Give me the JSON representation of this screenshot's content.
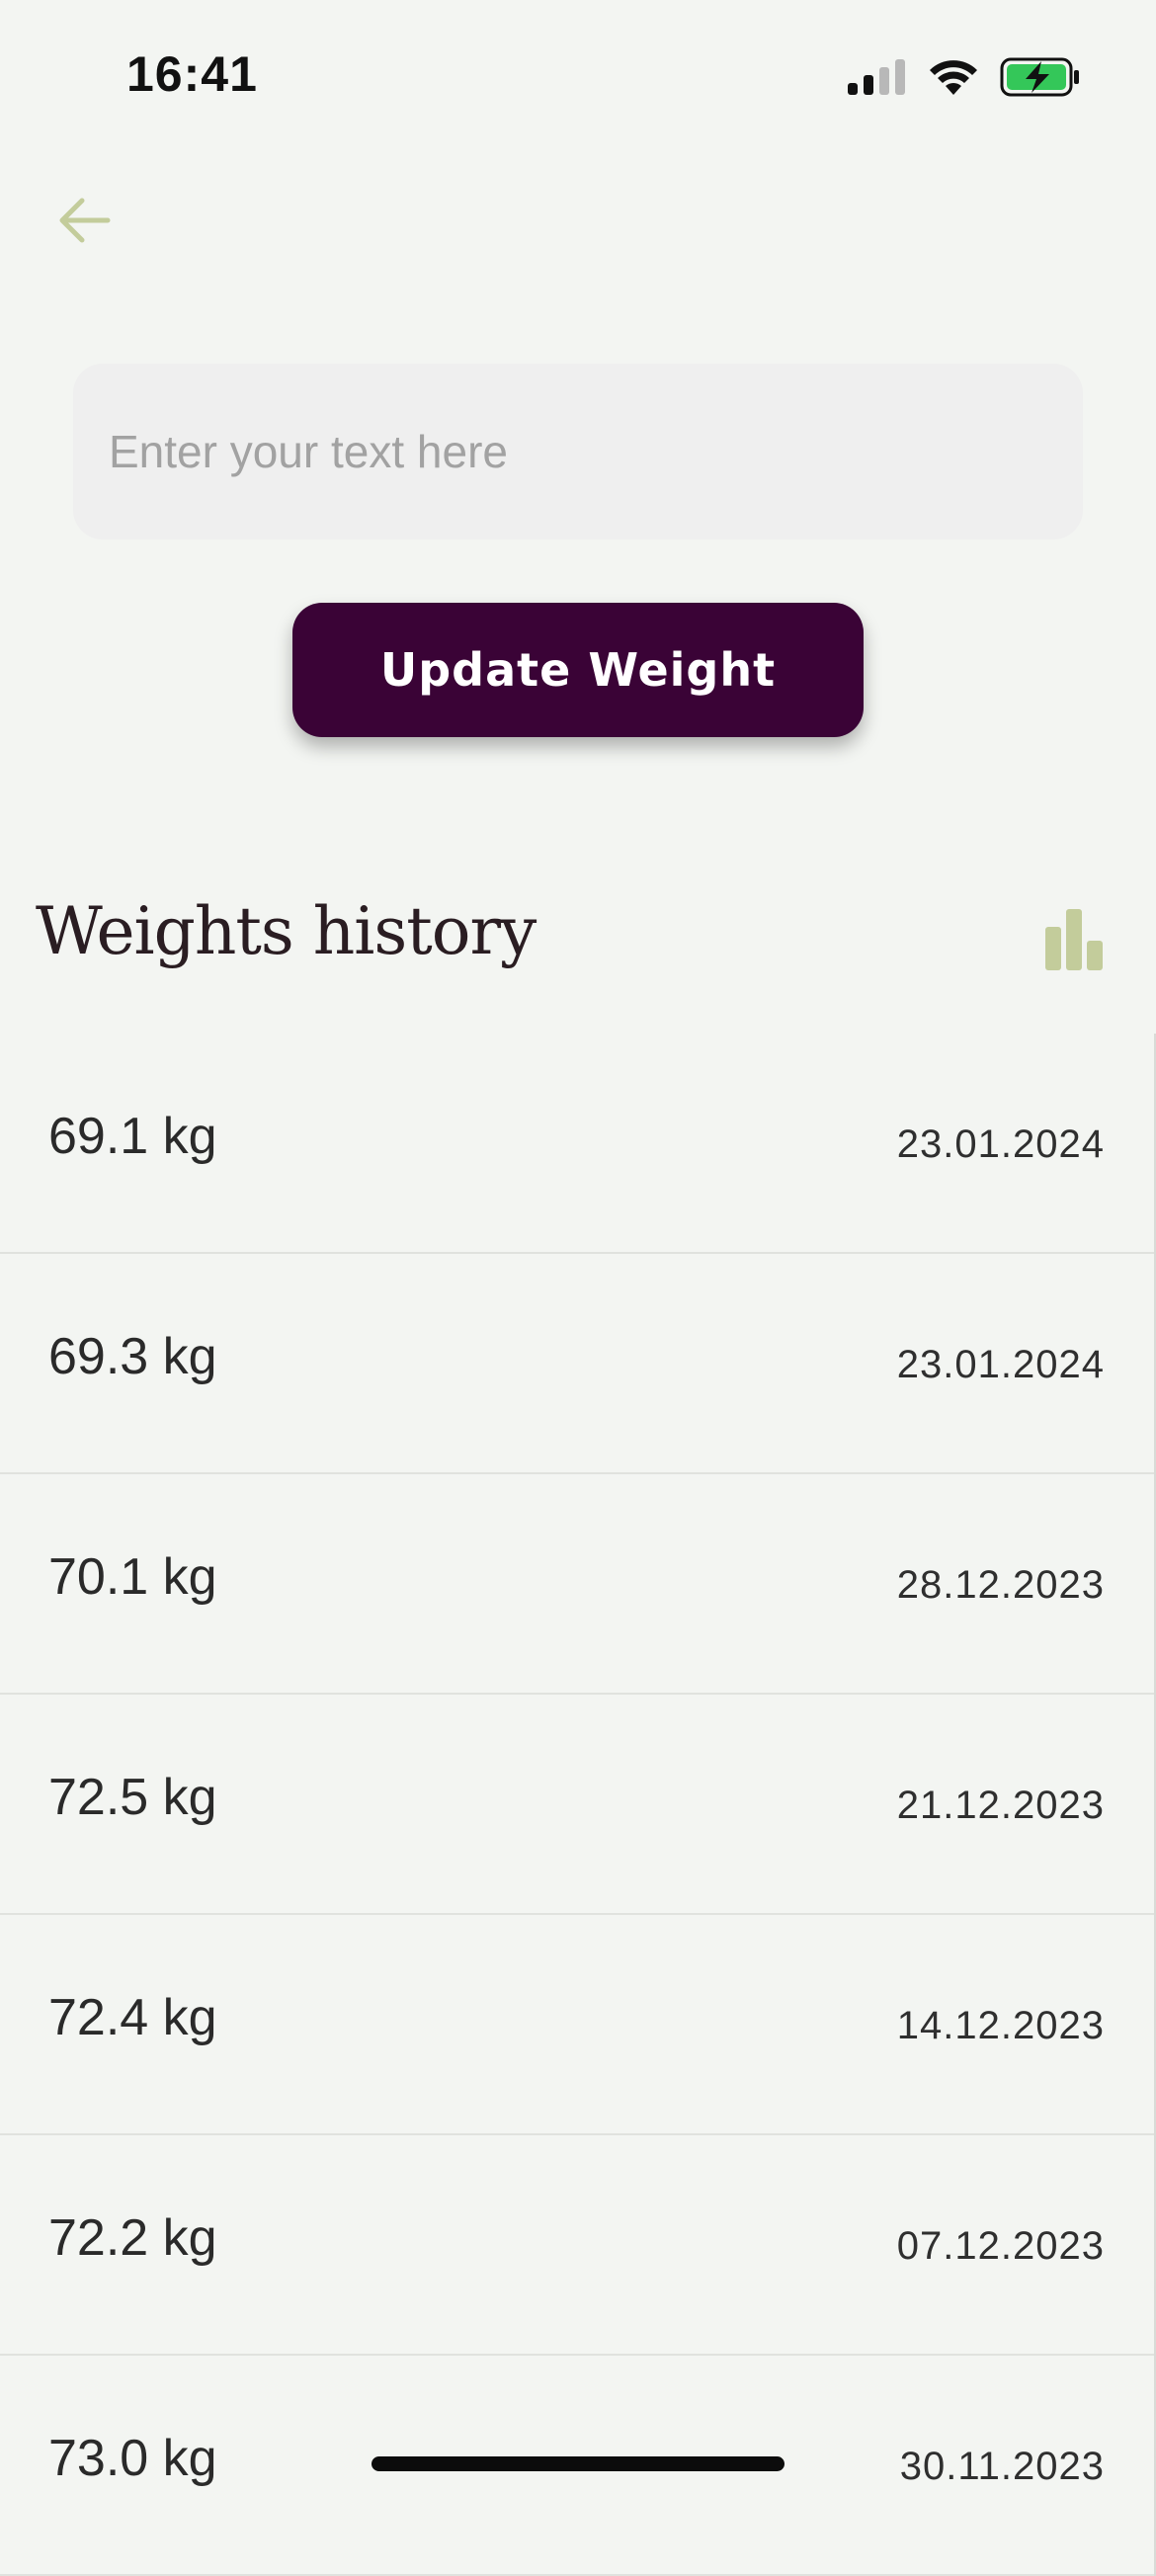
{
  "status_bar": {
    "time": "16:41"
  },
  "icons": {
    "back": "arrow-left-icon",
    "chart": "bar-chart-icon"
  },
  "colors": {
    "accent": "#c3cc9b",
    "button_bg": "#3a0336",
    "background": "#f3f5f2",
    "input_bg": "#efefef",
    "battery_green": "#34c759"
  },
  "input": {
    "placeholder": "Enter your text here",
    "value": ""
  },
  "update_button": {
    "label": "Update Weight"
  },
  "history": {
    "title": "Weights history",
    "entries": [
      {
        "weight": "69.1 kg",
        "date": "23.01.2024"
      },
      {
        "weight": "69.3 kg",
        "date": "23.01.2024"
      },
      {
        "weight": "70.1 kg",
        "date": "28.12.2023"
      },
      {
        "weight": "72.5 kg",
        "date": "21.12.2023"
      },
      {
        "weight": "72.4 kg",
        "date": "14.12.2023"
      },
      {
        "weight": "72.2 kg",
        "date": "07.12.2023"
      },
      {
        "weight": "73.0 kg",
        "date": "30.11.2023"
      }
    ]
  }
}
